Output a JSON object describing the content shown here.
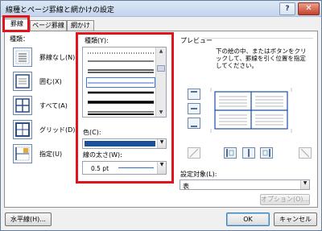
{
  "window": {
    "title": "線種とページ罫線と網かけの設定",
    "help": "?",
    "close": "✕"
  },
  "tabs": [
    {
      "label": "罫線"
    },
    {
      "label": "ページ罫線"
    },
    {
      "label": "網かけ"
    }
  ],
  "settings": {
    "heading": "種類：",
    "items": [
      {
        "label": "罫線なし(N)"
      },
      {
        "label": "囲む(X)"
      },
      {
        "label": "すべて(A)"
      },
      {
        "label": "グリッド(D)"
      },
      {
        "label": "指定(U)"
      }
    ]
  },
  "style": {
    "heading": "種類(Y):",
    "color_label": "色(C):",
    "width_label": "線の太さ(W):",
    "width_value": "0.5 pt",
    "color_value": "#1a4f9c"
  },
  "preview": {
    "heading": "プレビュー",
    "instruction": "下の絵の中、またはボタンをクリックして、罫線を引く位置を指定してください。"
  },
  "apply_to": {
    "label": "設定対象(L):",
    "value": "表"
  },
  "buttons": {
    "options": "オプション(O)...",
    "horizontal_line": "水平線(H)...",
    "ok": "OK",
    "cancel": "キャンセル"
  }
}
